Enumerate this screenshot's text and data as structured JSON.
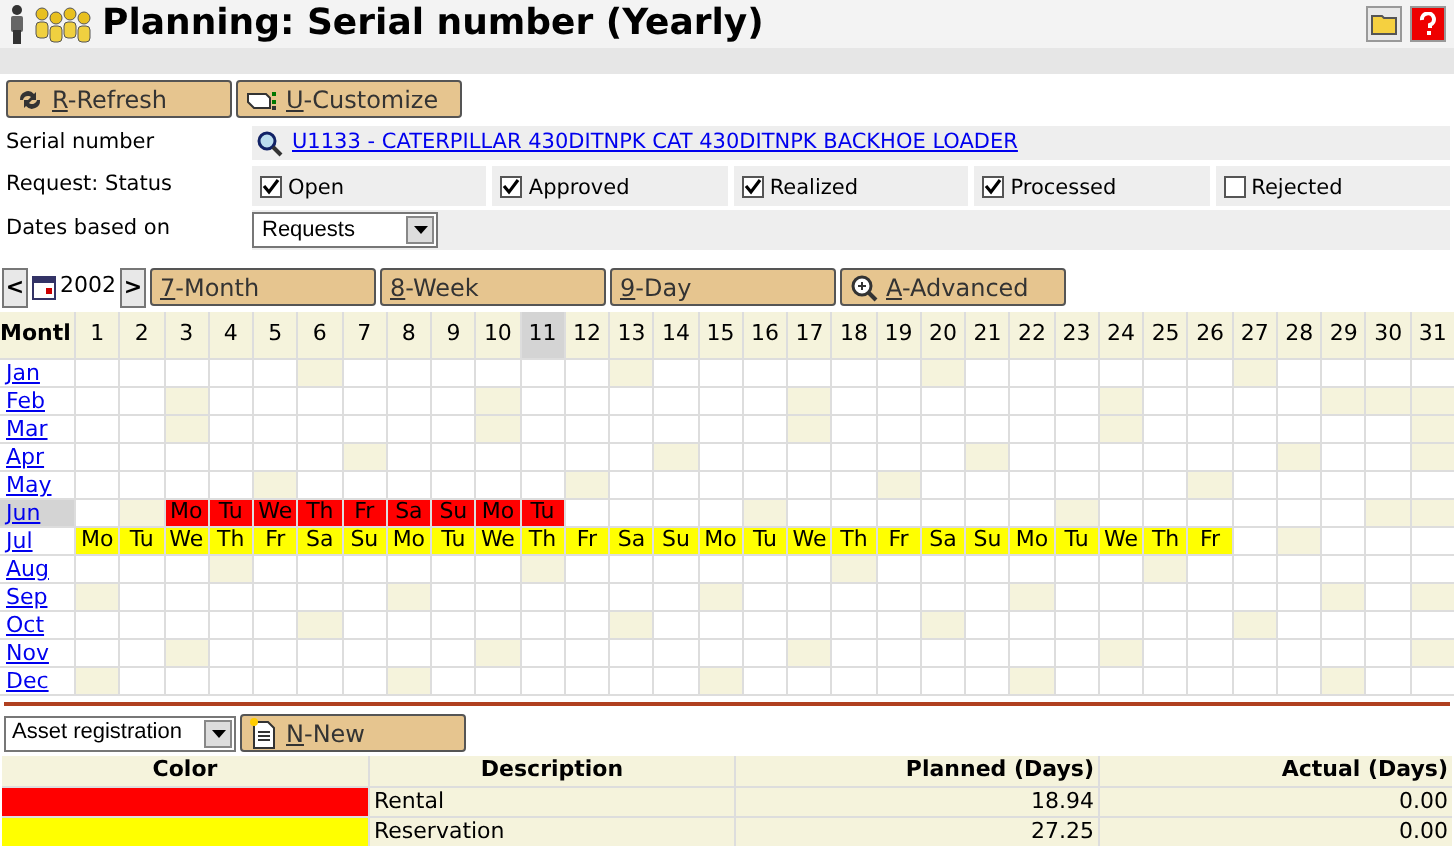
{
  "title": "Planning: Serial number (Yearly)",
  "toolbar": [
    {
      "label": "R-Refresh",
      "kind": "refresh"
    },
    {
      "label": "U-Customize",
      "kind": "customize"
    }
  ],
  "serial_number": {
    "label": "Serial number",
    "value": "U1133 - CATERPILLAR 430DITNPK CAT 430DITNPK BACKHOE LOADER"
  },
  "request_status": {
    "label": "Request: Status",
    "options": [
      {
        "label": "Open",
        "checked": true
      },
      {
        "label": "Approved",
        "checked": true
      },
      {
        "label": "Realized",
        "checked": true
      },
      {
        "label": "Processed",
        "checked": true
      },
      {
        "label": "Rejected",
        "checked": false
      }
    ]
  },
  "dates_based_on": {
    "label": "Dates based on",
    "value": "Requests"
  },
  "nav": {
    "prev": "<",
    "year": "2002",
    "next": ">",
    "views": [
      {
        "label": "7-Month",
        "kind": "plain"
      },
      {
        "label": "8-Week",
        "kind": "plain"
      },
      {
        "label": "9-Day",
        "kind": "plain"
      },
      {
        "label": "A-Advanced",
        "kind": "zoom"
      }
    ]
  },
  "calendar": {
    "corner": "Montl",
    "days": [
      {
        "label": "1",
        "selected": false
      },
      {
        "label": "2",
        "selected": false
      },
      {
        "label": "3",
        "selected": false
      },
      {
        "label": "4",
        "selected": false
      },
      {
        "label": "5",
        "selected": false
      },
      {
        "label": "6",
        "selected": false
      },
      {
        "label": "7",
        "selected": false
      },
      {
        "label": "8",
        "selected": false
      },
      {
        "label": "9",
        "selected": false
      },
      {
        "label": "10",
        "selected": false
      },
      {
        "label": "11",
        "selected": true
      },
      {
        "label": "12",
        "selected": false
      },
      {
        "label": "13",
        "selected": false
      },
      {
        "label": "14",
        "selected": false
      },
      {
        "label": "15",
        "selected": false
      },
      {
        "label": "16",
        "selected": false
      },
      {
        "label": "17",
        "selected": false
      },
      {
        "label": "18",
        "selected": false
      },
      {
        "label": "19",
        "selected": false
      },
      {
        "label": "20",
        "selected": false
      },
      {
        "label": "21",
        "selected": false
      },
      {
        "label": "22",
        "selected": false
      },
      {
        "label": "23",
        "selected": false
      },
      {
        "label": "24",
        "selected": false
      },
      {
        "label": "25",
        "selected": false
      },
      {
        "label": "26",
        "selected": false
      },
      {
        "label": "27",
        "selected": false
      },
      {
        "label": "28",
        "selected": false
      },
      {
        "label": "29",
        "selected": false
      },
      {
        "label": "30",
        "selected": false
      },
      {
        "label": "31",
        "selected": false
      }
    ],
    "months": [
      {
        "name": "Jan",
        "selected": false
      },
      {
        "name": "Feb",
        "selected": false
      },
      {
        "name": "Mar",
        "selected": false
      },
      {
        "name": "Apr",
        "selected": false
      },
      {
        "name": "May",
        "selected": false
      },
      {
        "name": "Jun",
        "selected": true,
        "cells": [
          {
            "kind": "free"
          },
          {
            "kind": "free"
          },
          {
            "kind": "booked",
            "label": "Mo",
            "color": "#ff0000"
          },
          {
            "kind": "booked",
            "label": "Tu",
            "color": "#ff0000"
          },
          {
            "kind": "booked",
            "label": "We",
            "color": "#ff0000"
          },
          {
            "kind": "booked",
            "label": "Th",
            "color": "#ff0000"
          },
          {
            "kind": "booked",
            "label": "Fr",
            "color": "#ff0000"
          },
          {
            "kind": "booked",
            "label": "Sa",
            "color": "#ff0000"
          },
          {
            "kind": "booked",
            "label": "Su",
            "color": "#ff0000"
          },
          {
            "kind": "booked",
            "label": "Mo",
            "color": "#ff0000"
          },
          {
            "kind": "booked",
            "label": "Tu",
            "color": "#ff0000"
          }
        ]
      },
      {
        "name": "Jul",
        "selected": false,
        "cells": [
          {
            "kind": "booked",
            "label": "Mo",
            "color": "#ffff00"
          },
          {
            "kind": "booked",
            "label": "Tu",
            "color": "#ffff00"
          },
          {
            "kind": "booked",
            "label": "We",
            "color": "#ffff00"
          },
          {
            "kind": "booked",
            "label": "Th",
            "color": "#ffff00"
          },
          {
            "kind": "booked",
            "label": "Fr",
            "color": "#ffff00"
          },
          {
            "kind": "booked",
            "label": "Sa",
            "color": "#ffff00"
          },
          {
            "kind": "booked",
            "label": "Su",
            "color": "#ffff00"
          },
          {
            "kind": "booked",
            "label": "Mo",
            "color": "#ffff00"
          },
          {
            "kind": "booked",
            "label": "Tu",
            "color": "#ffff00"
          },
          {
            "kind": "booked",
            "label": "We",
            "color": "#ffff00"
          },
          {
            "kind": "booked",
            "label": "Th",
            "color": "#ffff00"
          },
          {
            "kind": "booked",
            "label": "Fr",
            "color": "#ffff00"
          },
          {
            "kind": "booked",
            "label": "Sa",
            "color": "#ffff00"
          },
          {
            "kind": "booked",
            "label": "Su",
            "color": "#ffff00"
          },
          {
            "kind": "booked",
            "label": "Mo",
            "color": "#ffff00"
          },
          {
            "kind": "booked",
            "label": "Tu",
            "color": "#ffff00"
          },
          {
            "kind": "booked",
            "label": "We",
            "color": "#ffff00"
          },
          {
            "kind": "booked",
            "label": "Th",
            "color": "#ffff00"
          },
          {
            "kind": "booked",
            "label": "Fr",
            "color": "#ffff00"
          },
          {
            "kind": "booked",
            "label": "Sa",
            "color": "#ffff00"
          },
          {
            "kind": "booked",
            "label": "Su",
            "color": "#ffff00"
          },
          {
            "kind": "booked",
            "label": "Mo",
            "color": "#ffff00"
          },
          {
            "kind": "booked",
            "label": "Tu",
            "color": "#ffff00"
          },
          {
            "kind": "booked",
            "label": "We",
            "color": "#ffff00"
          },
          {
            "kind": "booked",
            "label": "Th",
            "color": "#ffff00"
          },
          {
            "kind": "booked",
            "label": "Fr",
            "color": "#ffff00"
          }
        ]
      },
      {
        "name": "Aug",
        "selected": false
      },
      {
        "name": "Sep",
        "selected": false
      },
      {
        "name": "Oct",
        "selected": false
      },
      {
        "name": "Nov",
        "selected": false
      },
      {
        "name": "Dec",
        "selected": false
      }
    ]
  },
  "asset_select": {
    "value": "Asset registration"
  },
  "new_button": {
    "label": "N-New"
  },
  "legend": {
    "columns": [
      "Color",
      "Description",
      "Planned (Days)",
      "Actual (Days)"
    ],
    "rows": [
      {
        "color": "#ff0000",
        "description": "Rental",
        "planned": "18.94",
        "actual": "0.00"
      },
      {
        "color": "#ffff00",
        "description": "Reservation",
        "planned": "27.25",
        "actual": "0.00"
      }
    ]
  }
}
